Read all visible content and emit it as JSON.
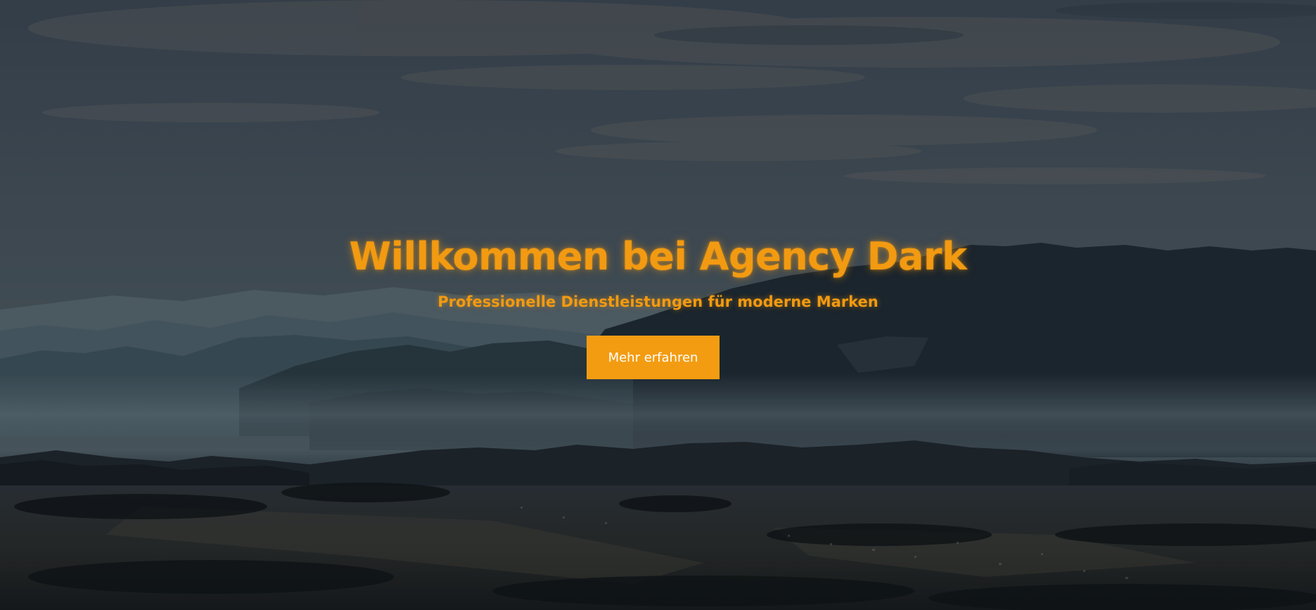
{
  "hero": {
    "title": "Willkommen bei Agency Dark",
    "subtitle": "Professionelle Dienstleistungen für moderne Marken",
    "button_label": "Mehr erfahren"
  },
  "colors": {
    "accent": "#f39c12",
    "button_text": "#ffffff",
    "background": "#1b232b"
  }
}
